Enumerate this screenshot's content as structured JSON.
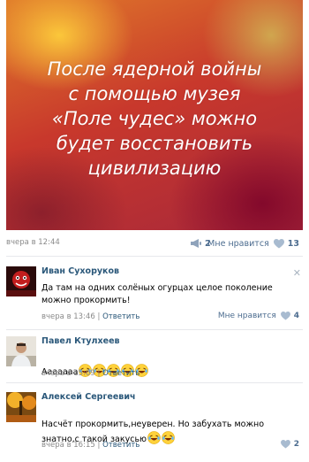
{
  "post": {
    "image_text": "После ядерной войны\nс помощью музея\n«Поле чудес» можно\nбудет восстановить\nцивилизацию",
    "date": "вчера в 12:44",
    "shares": "2",
    "like_label": "Мне нравится",
    "likes": "13"
  },
  "comments": [
    {
      "author": "Иван Сухоруков",
      "text": "Да там на одних солёных огурцах целое поколение\nможно прокормить!",
      "date": "вчера в 13:46",
      "reply": "Ответить",
      "like_label": "Мне нравится",
      "likes": "4"
    },
    {
      "author": "Павел Ктулхеев",
      "text": "Ааааааа",
      "emoji_count": 5,
      "date": "вчера в 15:09",
      "reply": "Ответить"
    },
    {
      "author": "Алексей Сергеевич",
      "text": "Насчёт прокормить,неуверен. Но забухать можно\nзнатно,с такой закусью",
      "emoji_count": 2,
      "date": "вчера в 16:15",
      "reply": "Ответить",
      "likes": "2"
    }
  ],
  "meta_separator": "|",
  "close_symbol": "✕",
  "icons": {
    "share": "megaphone-icon",
    "like": "heart-icon",
    "emoji": "laughing-tears-emoji"
  },
  "colors": {
    "link": "#2b587a",
    "like_blue": "#4c6c8f",
    "gray_text": "#8a8a8a"
  }
}
